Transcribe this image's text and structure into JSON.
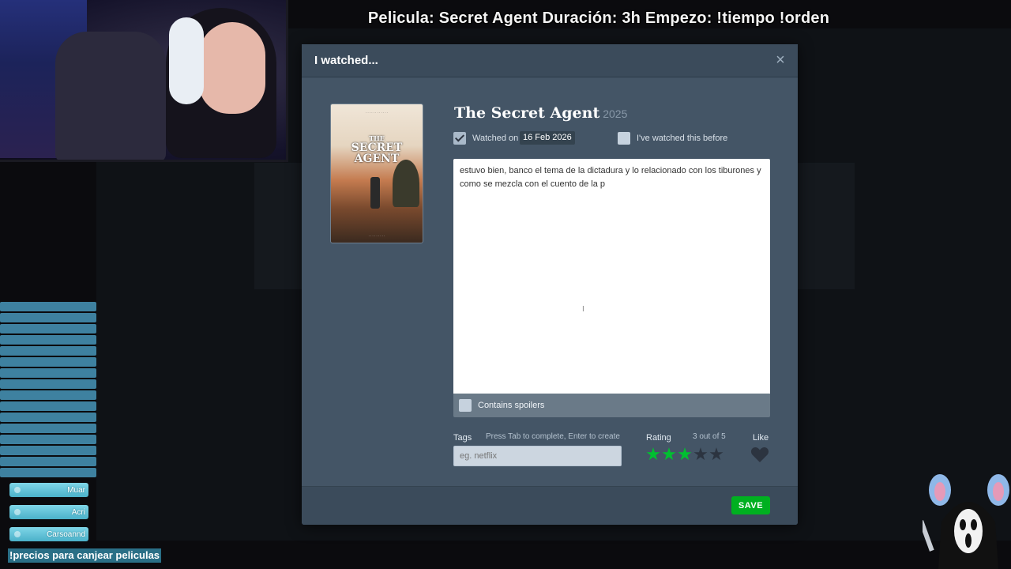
{
  "stream": {
    "title": "Pelicula: Secret Agent Duración: 3h Empezo: !tiempo !orden",
    "ticker": "!precios para canjear peliculas",
    "alerts": [
      "Muar",
      "Acri",
      "Carsoannd"
    ]
  },
  "modal": {
    "title": "I watched...",
    "close_icon": "close-icon",
    "film": {
      "title": "The Secret Agent",
      "year": "2025"
    },
    "poster": {
      "title_line1": "THE",
      "title_line2": "SECRET",
      "title_line3": "AGENT"
    },
    "watched_on_label": "Watched on",
    "watched_on_date": "16 Feb 2026",
    "watched_on_checked": true,
    "watched_before_label": "I've watched this before",
    "watched_before_checked": false,
    "review_text": "estuvo bien, banco el tema de la dictadura y lo relacionado con los tiburones y como se mezcla con el cuento de la p",
    "spoilers_label": "Contains spoilers",
    "spoilers_checked": false,
    "tags": {
      "label": "Tags",
      "hint": "Press Tab to complete, Enter to create",
      "placeholder": "eg. netflix"
    },
    "rating": {
      "label": "Rating",
      "value_text": "3 out of 5",
      "value": 3,
      "max": 5,
      "color_on": "#00c030",
      "color_off": "#2c3440"
    },
    "like": {
      "label": "Like",
      "liked": false
    },
    "save_label": "SAVE"
  }
}
